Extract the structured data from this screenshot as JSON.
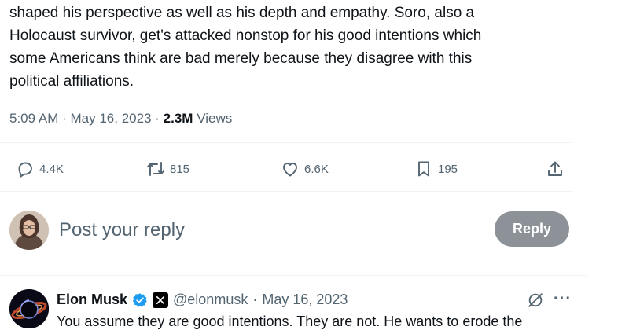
{
  "tweet": {
    "lines": [
      "shaped his perspective as well as his depth and empathy.  Soro, also a",
      "Holocaust survivor, get's attacked nonstop for his good intentions which",
      "some Americans think are bad merely because they disagree with this",
      "political affiliations."
    ],
    "time": "5:09 AM",
    "separator": "·",
    "date": "May 16, 2023",
    "views_count": "2.3M",
    "views_label": "Views"
  },
  "actions": {
    "replies": "4.4K",
    "reposts": "815",
    "likes": "6.6K",
    "bookmarks": "195",
    "icons": [
      "reply-icon",
      "repost-icon",
      "like-icon",
      "bookmark-icon",
      "share-icon"
    ]
  },
  "composer": {
    "placeholder": "Post your reply",
    "button_label": "Reply"
  },
  "reply": {
    "author": "Elon Musk",
    "handle": "@elonmusk",
    "separator": "·",
    "date": "May 16, 2023",
    "more": "···",
    "text": "You assume they are good intentions. They are not. He wants to erode the"
  },
  "colors": {
    "text": "#0f1419",
    "secondary": "#536471",
    "divider": "#eff3f4",
    "reply_button": "#8c9298",
    "verified": "#1d9bf0"
  }
}
